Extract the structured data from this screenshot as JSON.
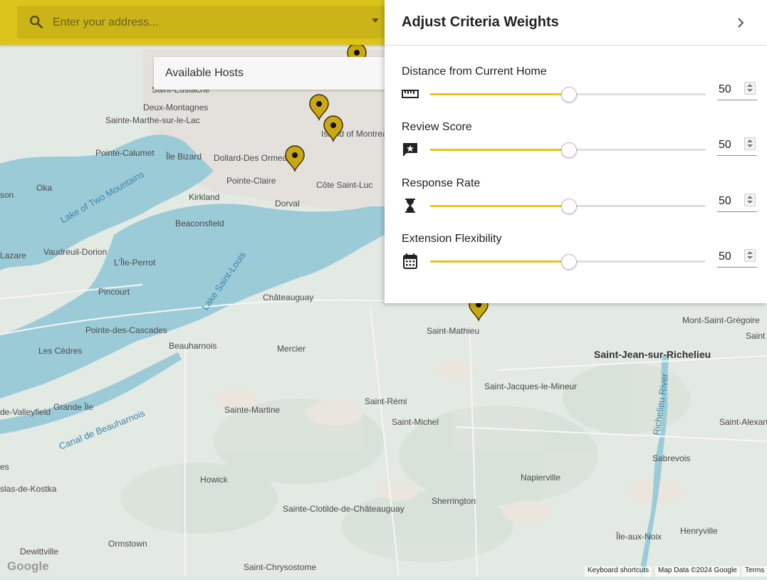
{
  "search": {
    "placeholder": "Enter your address..."
  },
  "hosts_dropdown": {
    "label": "Available Hosts"
  },
  "panel": {
    "title": "Adjust Criteria Weights",
    "criteria": [
      {
        "label": "Distance from Current Home",
        "value": "50",
        "icon": "ruler-icon"
      },
      {
        "label": "Review Score",
        "value": "50",
        "icon": "review-icon"
      },
      {
        "label": "Response Rate",
        "value": "50",
        "icon": "hourglass-icon"
      },
      {
        "label": "Extension Flexibility",
        "value": "50",
        "icon": "calendar-icon"
      }
    ],
    "slider_min": 0,
    "slider_max": 100
  },
  "map": {
    "towns": [
      "Saint-Eustache",
      "Deux-Montagnes",
      "Sainte-Marthe-sur-le-Lac",
      "Pointe-Calumet",
      "Île Bizard",
      "Dollard-Des Ormeaux",
      "Pointe-Claire",
      "Kirkland",
      "Oka",
      "Dorval",
      "Côte Saint-Luc",
      "Beaconsfield",
      "Vaudreuil-Dorion",
      "L'Île-Perrot",
      "Pincourt",
      "Châteauguay",
      "Pointe-des-Cascades",
      "Beauharnois",
      "Mercier",
      "Les Cèdres",
      "Saint-Mathieu",
      "Saint-Jean-sur-Richelieu",
      "Mont-Saint-Grégoire",
      "Saint-Jacques-le-Mineur",
      "Saint-Rémi",
      "Saint-Michel",
      "Sainte-Martine",
      "Grande Île",
      "Napierville",
      "Sabrevois",
      "Sherrington",
      "Howick",
      "Sainte-Clotilde-de-Châteauguay",
      "Henryville",
      "Île-aux-Noix",
      "Ormstown",
      "Dewittville",
      "Saint-Chrysostome",
      "Island of Montreal",
      "Lazare",
      "son",
      "de-Valleyfield",
      "es",
      "slas-de-Kostka",
      "Saint",
      "Saint-Alexan"
    ],
    "water": [
      "Lake of Two Mountains",
      "Lake Saint-Louis",
      "Canal de Beauharnois",
      "Richelieu River"
    ],
    "attribution": {
      "logo": "Google",
      "shortcuts": "Keyboard shortcuts",
      "data": "Map Data ©2024 Google",
      "terms": "Terms"
    }
  },
  "colors": {
    "accent": "#dcc31a",
    "slider_fill": "#e6c41a",
    "marker": "#c9a812"
  }
}
